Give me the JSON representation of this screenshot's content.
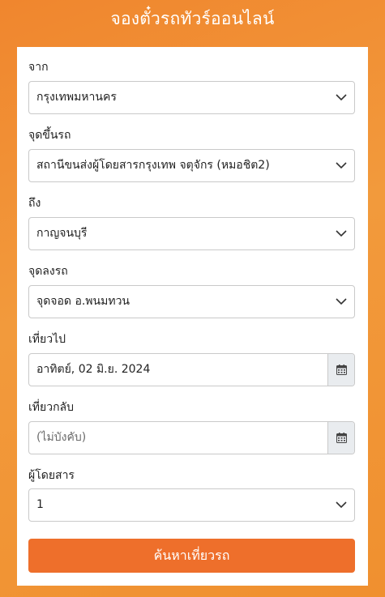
{
  "header": {
    "title": "จองตั๋วรถทัวร์ออนไลน์"
  },
  "form": {
    "from": {
      "label": "จาก",
      "value": "กรุงเทพมหานคร"
    },
    "pickup": {
      "label": "จุดขึ้นรถ",
      "value": "สถานีขนส่งผู้โดยสารกรุงเทพ จตุจักร (หมอชิต2)"
    },
    "to": {
      "label": "ถึง",
      "value": "กาญจนบุรี"
    },
    "dropoff": {
      "label": "จุดลงรถ",
      "value": "จุดจอด อ.พนมทวน"
    },
    "depart": {
      "label": "เที่ยวไป",
      "value": "อาทิตย์, 02 มิ.ย. 2024"
    },
    "return": {
      "label": "เที่ยวกลับ",
      "placeholder": "(ไม่บังคับ)"
    },
    "passengers": {
      "label": "ผู้โดยสาร",
      "value": "1"
    },
    "submit_label": "ค้นหาเที่ยวรถ"
  },
  "colors": {
    "background": "#f0902f",
    "button": "#ee6f2b",
    "card": "#ffffff"
  },
  "icons": {
    "select_arrow": "chevron-down-icon",
    "date_picker": "calendar-icon"
  }
}
